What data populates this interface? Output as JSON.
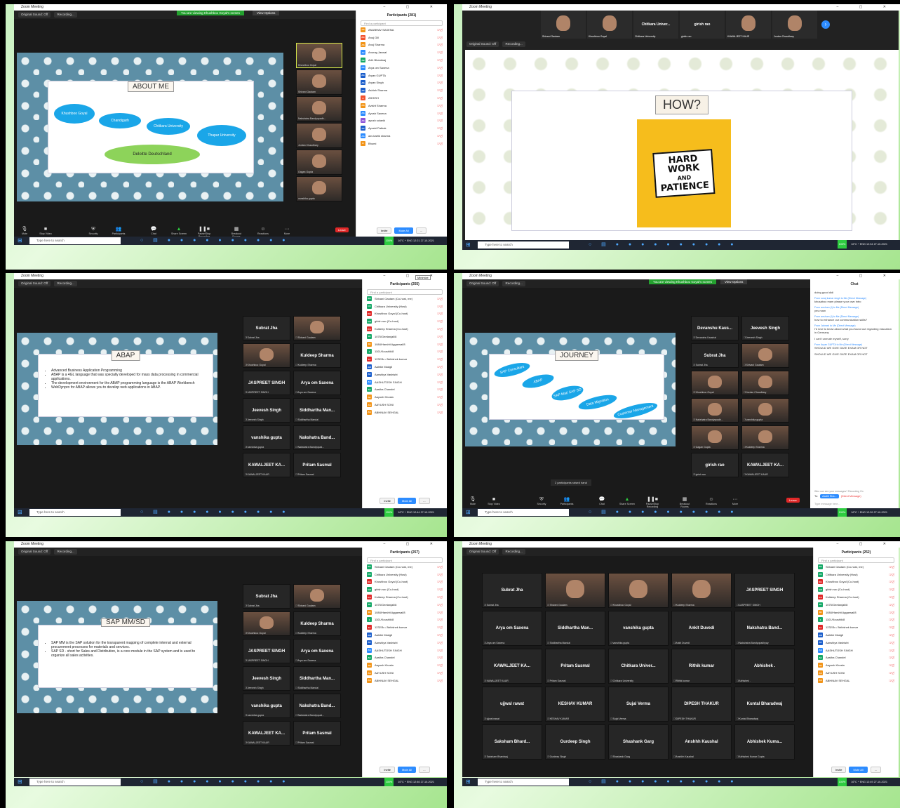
{
  "window_title": "Zoom Meeting",
  "common": {
    "original_sound": "Original Sound: Off",
    "recording": "Recording...",
    "search_placeholder": "Find a participant",
    "invite": "Invite",
    "mute_all": "Mute All",
    "taskbar_search": "Type here to search",
    "taskbar_pct": "100%",
    "temp": "16°C",
    "lang": "ENG",
    "date": "27-10-2021",
    "leave": "Leave",
    "view": "View",
    "view_options": "View Options",
    "share_banner": "You are viewing Khushboo Goyal's screen",
    "controls": [
      "Mute",
      "Stop Video",
      "Security",
      "Participants",
      "Chat",
      "Share Screen",
      "Pause/Stop Recording",
      "Breakout Rooms",
      "Reactions",
      "More"
    ]
  },
  "panel1": {
    "time": "12:21",
    "participants_title": "Participants (281)",
    "slide": {
      "title": "ABOUT ME",
      "bubbles": [
        "Khushboo Goyal",
        "Chandigarh",
        "Chitkara University",
        "Thapar University"
      ],
      "footer_bubble": "Deloitte Deutschland"
    },
    "videos": [
      "Khushboo Goyal",
      "Shivani Gautam",
      "Nakshatra Bandyopadh...",
      "Jordan Chaudhary",
      "Gagan Gupta",
      "vanshika gupta"
    ],
    "participants": [
      {
        "initials": "AS",
        "name": "ANUBHAV SAXENA",
        "color": "#f29418"
      },
      {
        "initials": "AG",
        "name": "Anuj Gill",
        "color": "#f2522e"
      },
      {
        "initials": "AS",
        "name": "Anuj Sharma",
        "color": "#f29418"
      },
      {
        "initials": "AJ",
        "name": "Anurag Jaswal",
        "color": "#2d8cff"
      },
      {
        "initials": "AB",
        "name": "Arth Bhardwaj",
        "color": "#15a867"
      },
      {
        "initials": "AS",
        "name": "Arya om Saxena",
        "color": "#2d8cff"
      },
      {
        "initials": "AG",
        "name": "Aryan GUPTA",
        "color": "#1b5ecb"
      },
      {
        "initials": "AS",
        "name": "Aryan Singh",
        "color": "#1b5ecb"
      },
      {
        "initials": "AS",
        "name": "Ashish Sharma",
        "color": "#1b5ecb"
      },
      {
        "initials": "A",
        "name": "ASHISH",
        "color": "#f2522e"
      },
      {
        "initials": "AS",
        "name": "Avisht Sharma",
        "color": "#f29418"
      },
      {
        "initials": "AS",
        "name": "Ayush Saxena",
        "color": "#2d8cff"
      },
      {
        "initials": "AS",
        "name": "ayush solanki",
        "color": "#8d54d8"
      },
      {
        "initials": "AP",
        "name": "Ayushi Pathak",
        "color": "#1b5ecb"
      },
      {
        "initials": "AS",
        "name": "azs kartik sharma",
        "color": "#2d8cff"
      },
      {
        "initials": "B",
        "name": "Bhumi",
        "color": "#f29418"
      }
    ]
  },
  "panel2": {
    "time": "12:34",
    "slide_title": "HOW?",
    "poster_lines": [
      "HARD",
      "WORK",
      "AND",
      "PATIENCE"
    ],
    "strip": [
      {
        "label": "",
        "name": "Shivani Gautam",
        "video": true
      },
      {
        "label": "",
        "name": "Khushboo Goyal",
        "video": true
      },
      {
        "label": "Chitkara Univer...",
        "name": "Chitkara University",
        "video": false
      },
      {
        "label": "girish rao",
        "name": "girish rao",
        "video": false
      },
      {
        "label": "",
        "name": "KAWALJEET KAUR",
        "video": true
      },
      {
        "label": "",
        "name": "Jordan Chaudhary",
        "video": true
      }
    ]
  },
  "panel3": {
    "time": "12:44",
    "participants_title": "Participants (255)",
    "minimize": "Minimize",
    "slide_title": "ABAP",
    "bullets": [
      "Advanced Business Application Programming",
      "ABAP is a 4GL language that was specially developed for mass data processing in commercial applications.",
      "The development environment for the ABAP programming language is the ABAP Workbench",
      "WebDynpro for ABAP allows you to develop web applications in ABAP."
    ],
    "tiles": [
      {
        "label": "Subrat Jha",
        "name": "Subrat Jha",
        "video": false
      },
      {
        "label": "",
        "name": "Shivani Gautam",
        "video": true
      },
      {
        "label": "",
        "name": "Khushboo Goyal",
        "video": true
      },
      {
        "label": "Kuldeep Sharma",
        "name": "Kuldeep Sharma",
        "video": false
      },
      {
        "label": "JASPREET SINGH",
        "name": "JASPREET SINGH",
        "video": false
      },
      {
        "label": "Arya om Saxena",
        "name": "Arya om Saxena",
        "video": false
      },
      {
        "label": "Jeevesh Singh",
        "name": "Jeevesh Singh",
        "video": false
      },
      {
        "label": "Siddhartha Man...",
        "name": "Siddhartha Mandal",
        "video": false
      },
      {
        "label": "vanshika gupta",
        "name": "vanshika gupta",
        "video": false
      },
      {
        "label": "Nakshatra Band...",
        "name": "Nakshatra Bandyopad...",
        "video": false
      },
      {
        "label": "KAWALJEET KA...",
        "name": "KAWALJEET KAUR",
        "video": false
      },
      {
        "label": "Pritam Sasmal",
        "name": "Pritam Sasmal",
        "video": false
      }
    ],
    "participants": [
      {
        "initials": "SG",
        "name": "Shivani Gautam (Co-host, me)",
        "color": "#15a867"
      },
      {
        "initials": "CU",
        "name": "Chitkara University (Host)",
        "color": "#15a867"
      },
      {
        "initials": "KG",
        "name": "Khushboo Goyal (Co-host)",
        "color": "#e02828"
      },
      {
        "initials": "GR",
        "name": "girish rao (Co-host)",
        "color": "#15a867"
      },
      {
        "initials": "KS",
        "name": "Kuldeep Sharma (Co-host)",
        "color": "#e02828"
      },
      {
        "initials": "1G",
        "name": "1075/Geetanjali/8",
        "color": "#15a867"
      },
      {
        "initials": "1H",
        "name": "1084/Harshit Aggarwal/8",
        "color": "#f29418"
      },
      {
        "initials": "1",
        "name": "1101/Koushik/8",
        "color": "#15a867"
      },
      {
        "initials": "1A",
        "name": "1232/3c / Abhishek kumar",
        "color": "#e02828"
      },
      {
        "initials": "AM",
        "name": "Aalekh Mudgil",
        "color": "#1b5ecb"
      },
      {
        "initials": "AV",
        "name": "Aanshiya Vashisht",
        "color": "#1b5ecb"
      },
      {
        "initials": "AS",
        "name": "AASHUTOSH SINGH",
        "color": "#2d8cff"
      },
      {
        "initials": "AC",
        "name": "Aastha Chandel",
        "color": "#15a867"
      },
      {
        "initials": "AK",
        "name": "Aayush Khosla",
        "color": "#f29418"
      },
      {
        "initials": "AS",
        "name": "AAYUSH SONI",
        "color": "#f29418"
      },
      {
        "initials": "AS",
        "name": "ABHINAV SEHGAL",
        "color": "#f29418"
      }
    ]
  },
  "panel4": {
    "time": "12:39",
    "chat_title": "Chat",
    "slide_title": "JOURNEY",
    "journey": [
      "SAP Consultant",
      "ABAP",
      "SAP Mat/ SAP SD",
      "Data Migration",
      "Customer Management"
    ],
    "raised_hand": "2 participants raised hand",
    "tiles": [
      {
        "label": "Devanshu Kaus...",
        "name": "Devanshu Kaushal",
        "video": false
      },
      {
        "label": "Jeevesh Singh",
        "name": "Jeevesh Singh",
        "video": false
      },
      {
        "label": "Subrat Jha",
        "name": "Subrat Jha",
        "video": false
      },
      {
        "label": "",
        "name": "Shivani Gautam",
        "video": true
      },
      {
        "label": "",
        "name": "Khushboo Goyal",
        "video": true
      },
      {
        "label": "",
        "name": "Jordan Chaudhary",
        "video": true
      },
      {
        "label": "",
        "name": "Nakshatra Bandyopadh...",
        "video": true
      },
      {
        "label": "",
        "name": "vanshika gupta",
        "video": true
      },
      {
        "label": "",
        "name": "Gagan Gupta",
        "video": true
      },
      {
        "label": "",
        "name": "Kuldeep Sharma",
        "video": true
      },
      {
        "label": "girish rao",
        "name": "girish rao",
        "video": false
      },
      {
        "label": "KAWALJEET KA...",
        "name": "KAWALJEET KAUR",
        "video": false
      }
    ],
    "chat": [
      {
        "from": "",
        "text": "doing good didi"
      },
      {
        "from": "From suraj kumar singh to Me (Direct Message)",
        "text": "khusaboo mam please your own intro"
      },
      {
        "from": "From anshum (I) to Me (Direct Message)",
        "text": "yes mam"
      },
      {
        "from": "From anshum (I) to Me (Direct Message)",
        "text": "how to enhance our communication skills?"
      },
      {
        "from": "From Jahnavi to Me (Direct Message)",
        "text": "I'd love to know about what you found out regarding education in Germany"
      },
      {
        "from": "",
        "text": "I can't unmute myself, sorry"
      },
      {
        "from": "From Aryan GUPTA to Me (Direct Message)",
        "text": "SHOULD WE GIVE GATE EXAM OR NOT"
      },
      {
        "from": "",
        "text": "SHOULD WE GIVE GATE EXAM OR NOT"
      }
    ],
    "who_can_see": "Who can see your messages? Recording On",
    "to_label": "To:",
    "to_value": "Aaditi Sha...",
    "direct": "(Direct Message)",
    "type_placeholder": "Type message here..."
  },
  "panel5": {
    "time": "12:46",
    "participants_title": "Participants (257)",
    "slide_title": "SAP MM/SD",
    "bullets": [
      "SAP MM is the SAP solution for the transparent mapping of complete internal and external procurement processes for materials and services.",
      "SAP SD - short for Sales and Distribution, is a core module in the SAP system and is used to organize all sales activities."
    ]
  },
  "panel6": {
    "time": "12:49",
    "participants_title": "Participants (252)",
    "grid": [
      {
        "label": "Subrat Jha",
        "name": "Subrat Jha",
        "video": false
      },
      {
        "label": "",
        "name": "Shivani Gautam",
        "video": true
      },
      {
        "label": "",
        "name": "Khushboo Goyal",
        "video": true
      },
      {
        "label": "",
        "name": "Kuldeep Sharma",
        "video": true
      },
      {
        "label": "JASPREET SINGH",
        "name": "JASPREET SINGH",
        "video": false
      },
      {
        "label": "Arya om Saxena",
        "name": "Arya om Saxena",
        "video": false
      },
      {
        "label": "Siddhartha Man...",
        "name": "Siddhartha Mandal",
        "video": false
      },
      {
        "label": "vanshika gupta",
        "name": "vanshika gupta",
        "video": false
      },
      {
        "label": "Ankit Duvedi",
        "name": "Ankit Duvedi",
        "video": false
      },
      {
        "label": "Nakshatra Band...",
        "name": "Nakshatra Bandyopadhyay",
        "video": false
      },
      {
        "label": "KAWALJEET KA...",
        "name": "KAWALJEET KAUR",
        "video": false
      },
      {
        "label": "Pritam Sasmal",
        "name": "Pritam Sasmal",
        "video": false
      },
      {
        "label": "Chitkara Univer...",
        "name": "Chitkara University",
        "video": false
      },
      {
        "label": "Rithik kumar",
        "name": "Rithik kumar",
        "video": false
      },
      {
        "label": "Abhishek .",
        "name": "Abhishek .",
        "video": false
      },
      {
        "label": "ujjwal rawat",
        "name": "ujjwal rawat",
        "video": false
      },
      {
        "label": "KESHAV KUMAR",
        "name": "KESHAV KUMAR",
        "video": false
      },
      {
        "label": "Sujal Verma",
        "name": "Sujal Verma",
        "video": false
      },
      {
        "label": "DIPESH THAKUR",
        "name": "DIPESH THAKUR",
        "video": false
      },
      {
        "label": "Kuntal Bharadwaj",
        "name": "Kuntal Bharadwaj",
        "video": false
      },
      {
        "label": "Saksham Bhard...",
        "name": "Saksham Bhardwaj",
        "video": false
      },
      {
        "label": "Gurdeep Singh",
        "name": "Gurdeep Singh",
        "video": false
      },
      {
        "label": "Shashank Garg",
        "name": "Shashank Garg",
        "video": false
      },
      {
        "label": "Anshhh Kaushal",
        "name": "Anshhh Kaushal",
        "video": false
      },
      {
        "label": "Abhishek Kuma...",
        "name": "Abhishek Kumar Gupta",
        "video": false
      }
    ]
  }
}
